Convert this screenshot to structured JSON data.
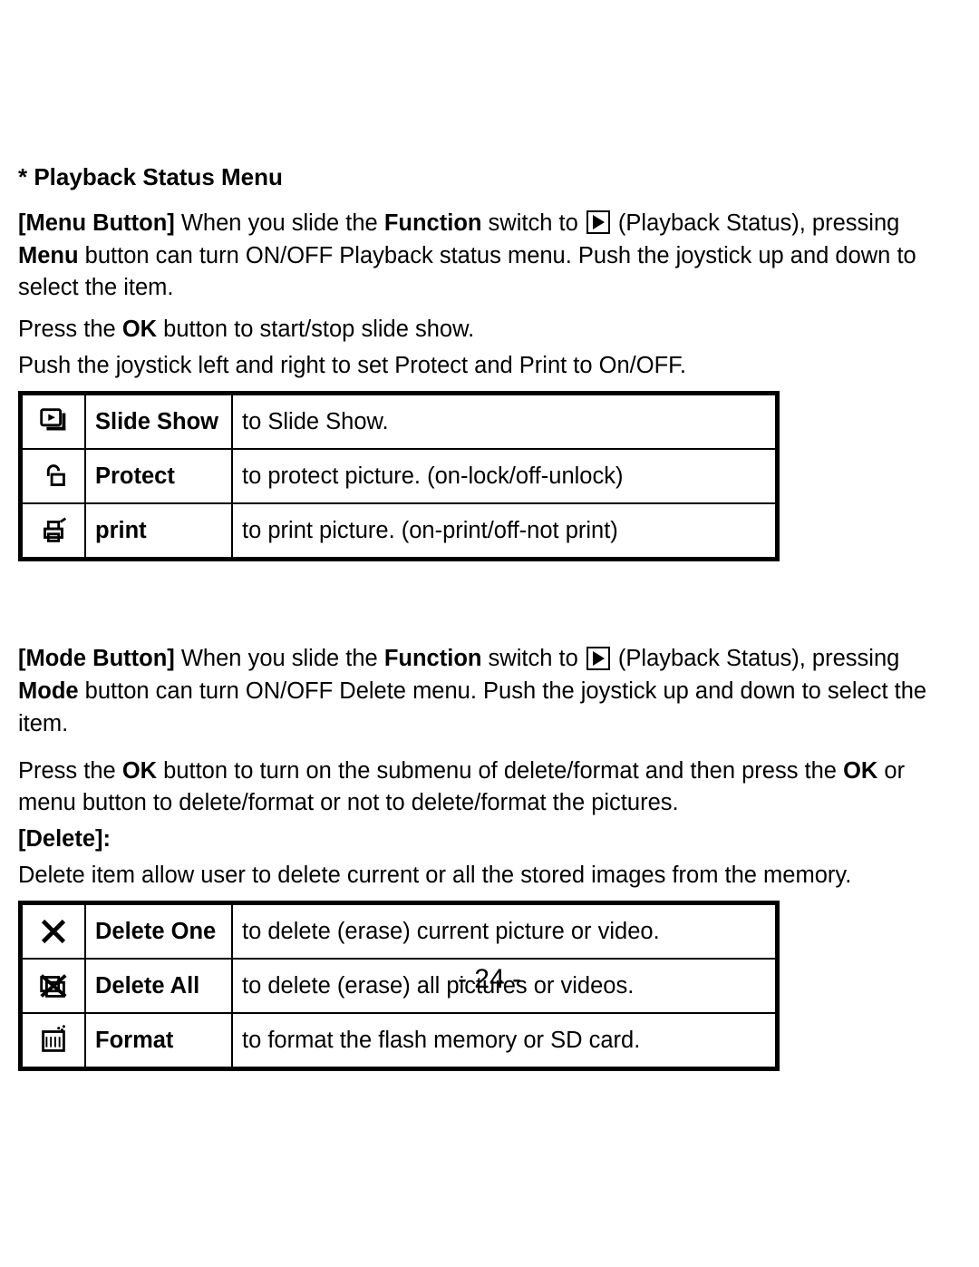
{
  "title": "* Playback Status Menu",
  "intro": {
    "menu_button": {
      "lead": "[Menu Button]",
      "a": " When you slide the ",
      "function": "Function",
      "b": " switch to ",
      "playback_status": " (Playback Status), pressing ",
      "menu_word": "Menu",
      "rest": " button can turn ON/OFF Playback status menu. Push the joystick up and down to select the item."
    },
    "ok_line_a": "Press the ",
    "ok_word": "OK",
    "ok_line_b": " button to start/stop slide show.",
    "joystick_line": "Push the joystick left and right to set Protect and Print to On/OFF."
  },
  "table1": {
    "rows": [
      {
        "icon": "slideshow-icon",
        "label": "Slide Show",
        "desc": "to Slide Show."
      },
      {
        "icon": "protect-icon",
        "label": "Protect",
        "desc": "to protect picture. (on-lock/off-unlock)"
      },
      {
        "icon": "print-icon",
        "label": "print",
        "desc": "to print picture. (on-print/off-not print)"
      }
    ]
  },
  "mode": {
    "lead": "[Mode Button]",
    "a": " When you slide the ",
    "function": "Function",
    "b": " switch to ",
    "playback_status": " (Playback Status), pressing ",
    "mode_word": "Mode",
    "rest": " button can turn ON/OFF Delete menu. Push the joystick up and down to select the item.",
    "ok_a": "Press the ",
    "ok_word": "OK",
    "ok_b": " button to turn on the submenu of delete/format and then press the ",
    "ok_word2": "OK",
    "ok_c": " or menu button to delete/format or not to delete/format the pictures."
  },
  "delete": {
    "heading": "[Delete]:",
    "intro": "Delete item allow user to delete current or all the stored images from the memory."
  },
  "table2": {
    "rows": [
      {
        "icon": "delete-one-icon",
        "label": "Delete One",
        "desc": "to delete (erase) current picture or video."
      },
      {
        "icon": "delete-all-icon",
        "label": "Delete All",
        "desc": "to delete (erase) all pictures or videos."
      },
      {
        "icon": "format-icon",
        "label": "Format",
        "desc": "to format the flash memory or SD card."
      }
    ]
  },
  "page_number": "- 24 -"
}
